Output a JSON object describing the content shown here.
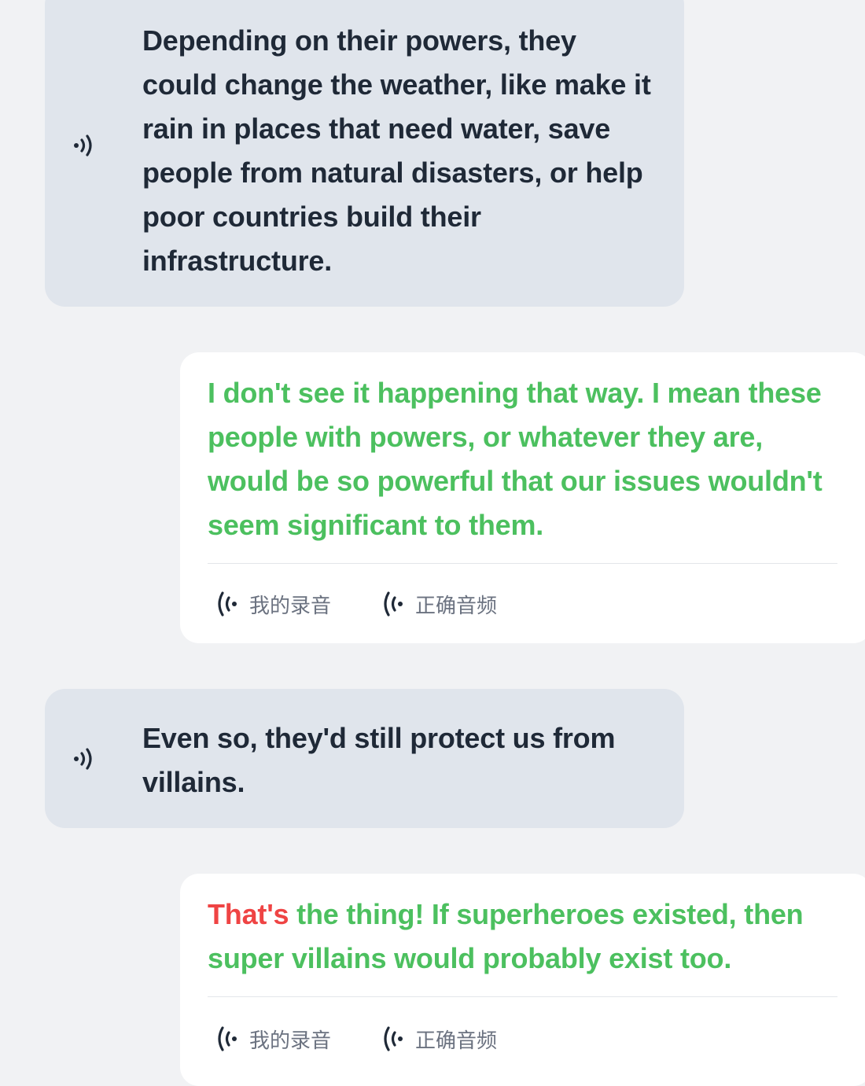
{
  "messages": [
    {
      "role": "partner",
      "text": "Depending on their powers, they could change the weather, like make it rain in places that need water, save people from natural disasters, or help poor countries build their infrastructure.",
      "icon": "speaker-icon"
    },
    {
      "role": "user",
      "text": "I don't see it happening that way. I mean these people with powers, or whatever they are, would be so powerful that our issues wouldn't seem significant to them.",
      "buttons": {
        "my_recording": "我的录音",
        "correct_audio": "正确音频"
      }
    },
    {
      "role": "partner",
      "text": "Even so, they'd still protect us from villains.",
      "icon": "speaker-icon"
    },
    {
      "role": "user",
      "text_wrong": "That's",
      "text_rest": " the thing! If superheroes existed, then super villains would probably exist too.",
      "buttons": {
        "my_recording": "我的录音",
        "correct_audio": "正确音频"
      }
    }
  ],
  "colors": {
    "correct_text": "#4cc05f",
    "wrong_text": "#ef4444",
    "partner_text": "#1f2937",
    "partner_bubble": "#e0e5ec",
    "user_bubble": "#ffffff",
    "page_background": "#f1f2f4"
  }
}
